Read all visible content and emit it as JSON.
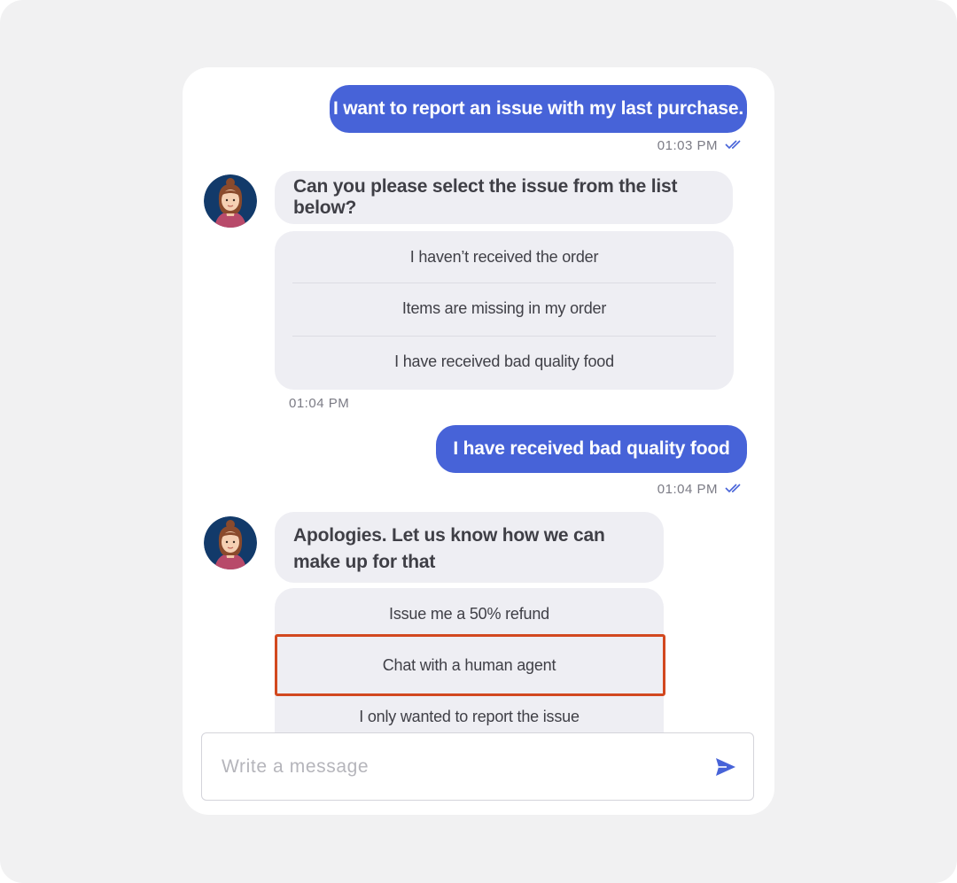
{
  "conversation": {
    "messages": [
      {
        "from": "user",
        "text": "I want to report an issue with my last purchase.",
        "time": "01:03 PM"
      },
      {
        "from": "bot",
        "text": "Can you please select the issue from the list below?",
        "options": [
          "I haven’t received the order",
          "Items are missing in my order",
          "I have received bad quality food"
        ],
        "time": "01:04 PM"
      },
      {
        "from": "user",
        "text": "I have received bad quality food",
        "time": "01:04 PM"
      },
      {
        "from": "bot",
        "text": "Apologies. Let us know how we can make up for that",
        "options": [
          "Issue me a 50% refund",
          "Chat with a human agent",
          "I only wanted to report the issue"
        ],
        "highlighted_option": "Chat with a human agent"
      }
    ]
  },
  "composer": {
    "placeholder": "Write a message",
    "send_icon": "send-icon"
  },
  "colors": {
    "user_bubble": "#4763d8",
    "bot_bubble": "#eeeef3",
    "highlight_border": "#d2481f",
    "read_check": "#4763d8"
  }
}
